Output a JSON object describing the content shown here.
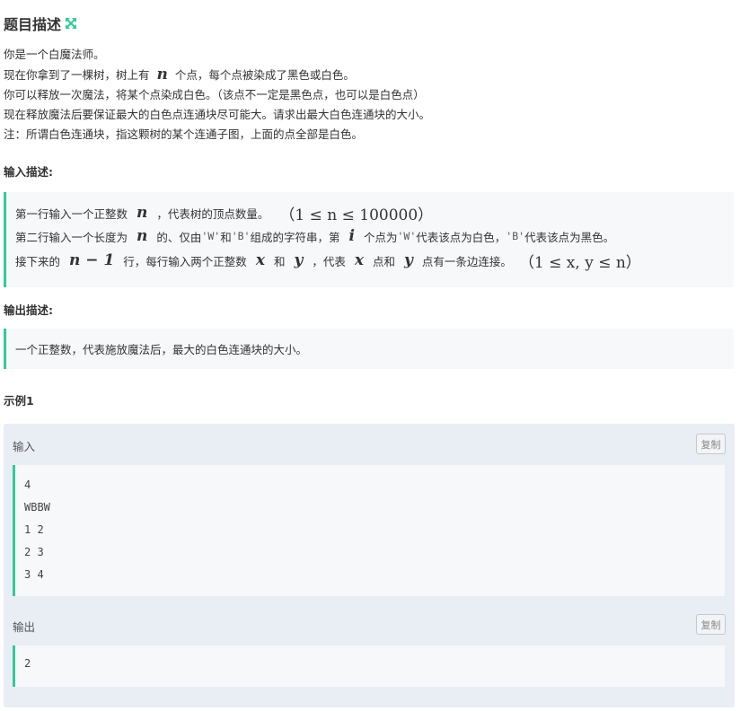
{
  "header": {
    "title": "题目描述",
    "icon": "expand-icon",
    "accent": "#32ca99"
  },
  "description": {
    "line1": "你是一个白魔法师。",
    "line2_a": "现在你拿到了一棵树，树上有",
    "line2_var": "n",
    "line2_b": "个点，每个点被染成了黑色或白色。",
    "line3": "你可以释放一次魔法，将某个点染成白色。（该点不一定是黑色点，也可以是白色点）",
    "line4": "现在释放魔法后要保证最大的白色点连通块尽可能大。请求出最大白色连通块的大小。",
    "line5": "注：所谓白色连通块，指这颗树的某个连通子图，上面的点全部是白色。"
  },
  "input_section": {
    "heading": "输入描述:",
    "l1_a": "第一行输入一个正整数",
    "l1_var": "n",
    "l1_b": "，代表树的顶点数量。",
    "l1_math": "（1 ≤ n ≤ 100000）",
    "l2_a": "第二行输入一个长度为",
    "l2_var": "n",
    "l2_b": "的、仅由",
    "l2_w": "'W'",
    "l2_c": "和",
    "l2_bch": "'B'",
    "l2_d": "组成的字符串，第",
    "l2_i": "i",
    "l2_e": "个点为",
    "l2_w2": "'W'",
    "l2_f": "代表该点为白色，",
    "l2_b2": "'B'",
    "l2_g": "代表该点为黑色。",
    "l3_a": "接下来的",
    "l3_math1": "n − 1",
    "l3_b": "行，每行输入两个正整数",
    "l3_x": "x",
    "l3_c": "和",
    "l3_y": "y",
    "l3_d": "，代表",
    "l3_x2": "x",
    "l3_e": "点和",
    "l3_y2": "y",
    "l3_f": "点有一条边连接。",
    "l3_math2": "（1 ≤ x, y ≤ n）"
  },
  "output_section": {
    "heading": "输出描述:",
    "text": "一个正整数，代表施放魔法后，最大的白色连通块的大小。"
  },
  "example": {
    "heading": "示例1",
    "input_label": "输入",
    "output_label": "输出",
    "copy_label": "复制",
    "input_lines": [
      "4",
      "WBBW",
      "1 2",
      "2 3",
      "3 4"
    ],
    "output_lines": [
      "2"
    ]
  }
}
